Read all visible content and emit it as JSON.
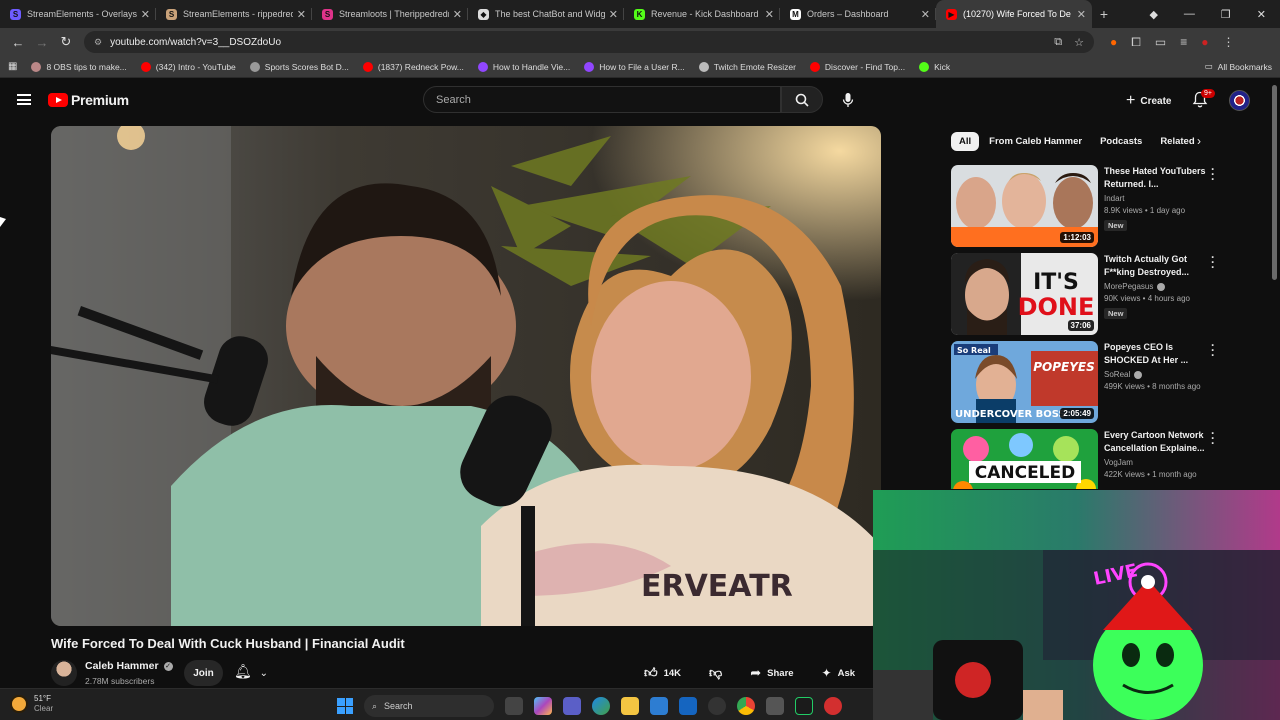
{
  "browser": {
    "tabs": [
      {
        "title": "StreamElements - Overlays",
        "color": "#6e5cff",
        "icon_text": "S"
      },
      {
        "title": "StreamElements - rippedredne",
        "color": "#c9a27a",
        "icon_text": "S"
      },
      {
        "title": "Streamloots | Therippedredne",
        "color": "#e0338a",
        "icon_text": "S"
      },
      {
        "title": "The best ChatBot and Widgets",
        "color": "#dddddd",
        "icon_text": "◆"
      },
      {
        "title": "Revenue - Kick Dashboard",
        "color": "#53fc18",
        "icon_text": "K"
      },
      {
        "title": "Orders – Dashboard",
        "color": "#ffffff",
        "icon_text": "M"
      },
      {
        "title": "(10270) Wife Forced To De",
        "color": "#ff0000",
        "icon_text": "▶"
      }
    ],
    "url": "youtube.com/watch?v=3__DSOZdoUo",
    "bookmarks": [
      {
        "label": "8 OBS tips to make...",
        "color": "#b88"
      },
      {
        "label": "(342) Intro - YouTube",
        "color": "#ff0000"
      },
      {
        "label": "Sports Scores Bot D...",
        "color": "#999"
      },
      {
        "label": "(1837) Redneck Pow...",
        "color": "#ff0000"
      },
      {
        "label": "How to Handle Vie...",
        "color": "#9146ff"
      },
      {
        "label": "How to File a User R...",
        "color": "#9146ff"
      },
      {
        "label": "Twitch Emote Resizer",
        "color": "#bbb"
      },
      {
        "label": "Discover - Find Top...",
        "color": "#ff0000"
      },
      {
        "label": "Kick",
        "color": "#53fc18"
      }
    ],
    "all_bookmarks": "All Bookmarks"
  },
  "youtube": {
    "logo": "Premium",
    "search_placeholder": "Search",
    "create": "Create",
    "notif_badge": "9+",
    "video": {
      "title": "Wife Forced To Deal With Cuck Husband | Financial Audit",
      "channel": "Caleb Hammer",
      "subscribers": "2.78M subscribers",
      "join": "Join",
      "likes": "14K",
      "share": "Share",
      "ask": "Ask"
    },
    "chips": [
      "All",
      "From Caleb Hammer",
      "Podcasts",
      "Related"
    ],
    "recommendations": [
      {
        "title": "These Hated YouTubers Returned. I...",
        "channel": "Indart",
        "meta": "8.9K views • 1 day ago",
        "badge": "New",
        "duration": "1:12:03",
        "verified": false
      },
      {
        "title": "Twitch Actually Got F**king Destroyed...",
        "channel": "MorePegasus",
        "meta": "90K views • 4 hours ago",
        "badge": "New",
        "duration": "37:06",
        "verified": true
      },
      {
        "title": "Popeyes CEO Is SHOCKED At Her ...",
        "channel": "SoReal",
        "meta": "499K views • 8 months ago",
        "badge": "",
        "duration": "2:05:49",
        "verified": true
      },
      {
        "title": "Every Cartoon Network Cancellation Explaine...",
        "channel": "VogJam",
        "meta": "422K views • 1 month ago",
        "badge": "",
        "duration": "",
        "verified": false
      }
    ],
    "thumb_text": {
      "done_1": "IT'S",
      "done_2": "DONE",
      "undercover": "UNDERCOVER BOSS",
      "so_real": "So Real",
      "canceled": "CANCELED"
    }
  },
  "taskbar": {
    "temp": "51°F",
    "condition": "Clear",
    "search": "Search"
  }
}
